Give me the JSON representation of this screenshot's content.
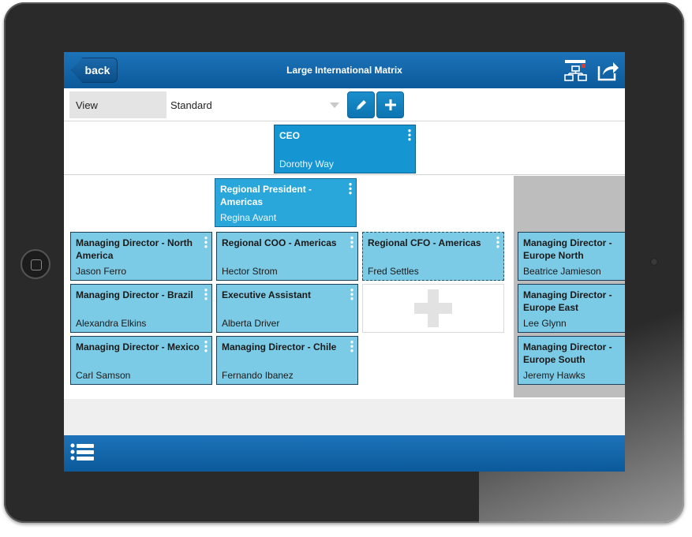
{
  "header": {
    "back_label": "back",
    "title": "Large International Matrix"
  },
  "toolbar": {
    "view_label": "View",
    "view_value": "Standard"
  },
  "cards": {
    "ceo": {
      "title": "CEO",
      "name": "Dorothy Way"
    },
    "regional_president": {
      "title": "Regional President - Americas",
      "name": "Regina Avant"
    },
    "md_north_america": {
      "title": "Managing Director - North America",
      "name": "Jason Ferro"
    },
    "regional_coo": {
      "title": "Regional COO - Americas",
      "name": "Hector Strom"
    },
    "regional_cfo": {
      "title": "Regional CFO - Americas",
      "name": "Fred Settles"
    },
    "md_brazil": {
      "title": "Managing Director - Brazil",
      "name": "Alexandra Elkins"
    },
    "exec_assistant": {
      "title": "Executive Assistant",
      "name": "Alberta Driver"
    },
    "md_mexico": {
      "title": "Managing Director - Mexico",
      "name": "Carl Samson"
    },
    "md_chile": {
      "title": "Managing Director - Chile",
      "name": "Fernando Ibanez"
    },
    "md_europe_north": {
      "title": "Managing Director - Europe North",
      "name": "Beatrice Jamieson"
    },
    "md_europe_east": {
      "title": "Managing Director - Europe East",
      "name": "Lee Glynn"
    },
    "md_europe_south": {
      "title": "Managing Director - Europe South",
      "name": "Jeremy Hawks"
    }
  },
  "colors": {
    "bar_blue": "#0b5a9a",
    "card_light": "#7ccbe6",
    "card_dark": "#1596d3",
    "button_blue": "#0c74b1"
  },
  "icons": {
    "back": "back-arrow-icon",
    "hierarchy": "org-chart-icon",
    "share": "share-icon",
    "edit": "pencil-icon",
    "add": "plus-icon",
    "menu": "vertical-dots-icon",
    "list": "list-icon"
  }
}
